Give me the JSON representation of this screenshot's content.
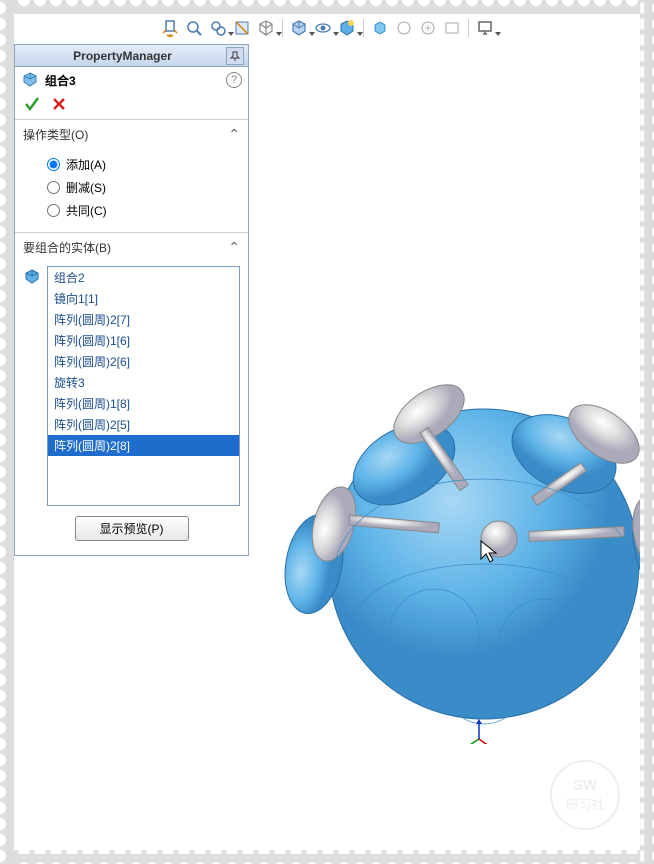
{
  "panel": {
    "title": "PropertyManager",
    "feature_name": "组合3"
  },
  "operation": {
    "title": "操作类型(O)",
    "options": [
      {
        "label": "添加(A)",
        "checked": true
      },
      {
        "label": "删减(S)",
        "checked": false
      },
      {
        "label": "共同(C)",
        "checked": false
      }
    ]
  },
  "entities": {
    "title": "要组合的实体(B)",
    "items": [
      {
        "label": "组合2",
        "selected": false
      },
      {
        "label": "镜向1[1]",
        "selected": false
      },
      {
        "label": "阵列(圆周)2[7]",
        "selected": false
      },
      {
        "label": "阵列(圆周)1[6]",
        "selected": false
      },
      {
        "label": "阵列(圆周)2[6]",
        "selected": false
      },
      {
        "label": "旋转3",
        "selected": false
      },
      {
        "label": "阵列(圆周)1[8]",
        "selected": false
      },
      {
        "label": "阵列(圆周)2[5]",
        "selected": false
      },
      {
        "label": "阵列(圆周)2[8]",
        "selected": true
      }
    ],
    "preview_button": "显示预览(P)"
  }
}
